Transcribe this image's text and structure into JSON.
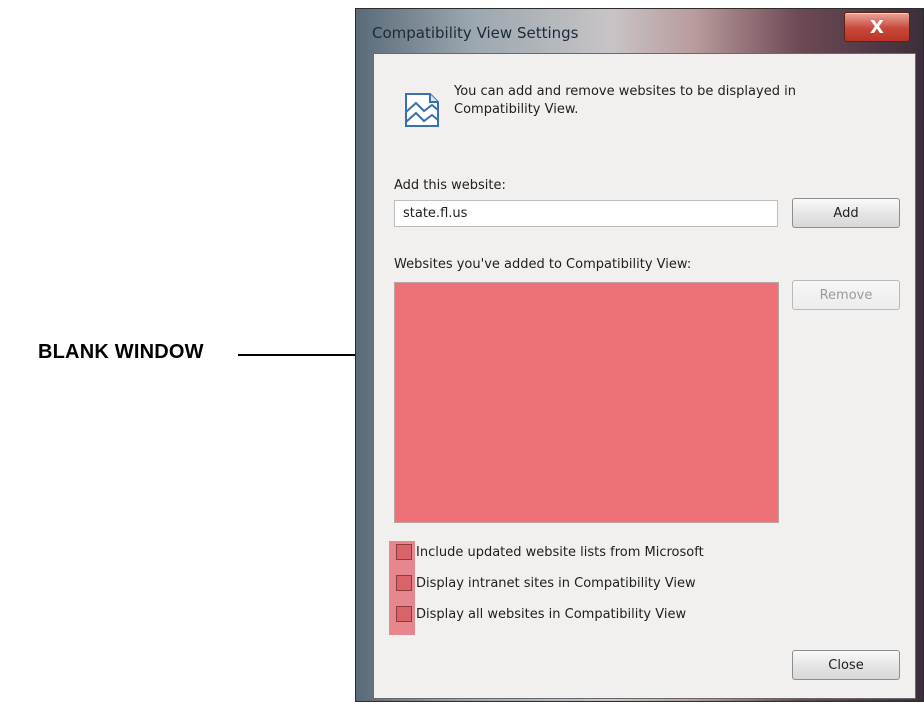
{
  "annotation": {
    "label": "BLANK WINDOW"
  },
  "window": {
    "title": "Compatibility View Settings",
    "close_glyph": "X"
  },
  "info": {
    "text": "You can add and remove websites to be displayed in Compatibility View.",
    "icon": "compatibility-view-icon"
  },
  "add_section": {
    "label": "Add this website:",
    "input_value": "state.fl.us",
    "add_button": "Add"
  },
  "list_section": {
    "label": "Websites you've added to Compatibility View:",
    "items": [],
    "remove_button": "Remove"
  },
  "options": [
    {
      "label": "Include updated website lists from Microsoft",
      "checked": false
    },
    {
      "label": "Display intranet sites in Compatibility View",
      "checked": false
    },
    {
      "label": "Display all websites in Compatibility View",
      "checked": false
    }
  ],
  "footer": {
    "close_button": "Close"
  },
  "colors": {
    "highlight": "#ec7277",
    "client_bg": "#f1f0ee"
  }
}
